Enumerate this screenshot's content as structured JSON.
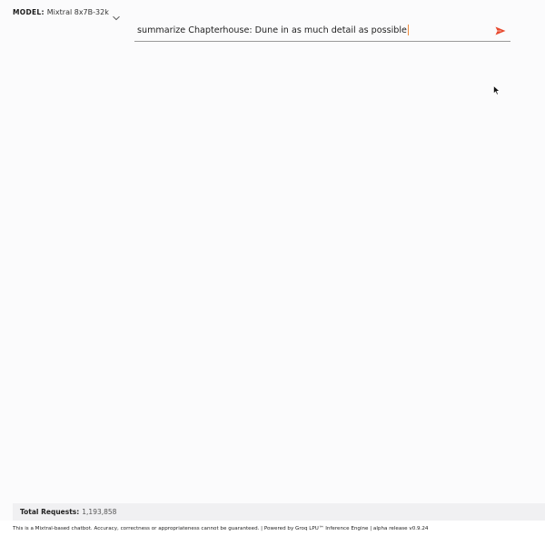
{
  "header": {
    "model_label": "MODEL:",
    "model_value": "Mixtral 8x7B-32k",
    "dropdown_icon": "chevron-down-icon"
  },
  "prompt": {
    "value": "summarize Chapterhouse: Dune in as much detail as possible",
    "send_icon": "send-icon",
    "send_color": "#e8492e"
  },
  "stats": {
    "total_requests_label": "Total Requests:",
    "total_requests_value": "1,193,858"
  },
  "footer": {
    "text": "This is a Mixtral-based chatbot. Accuracy, correctness or appropriateness cannot be guaranteed. | Powered by Groq LPU™ Inference Engine | alpha release v0.9.24"
  }
}
